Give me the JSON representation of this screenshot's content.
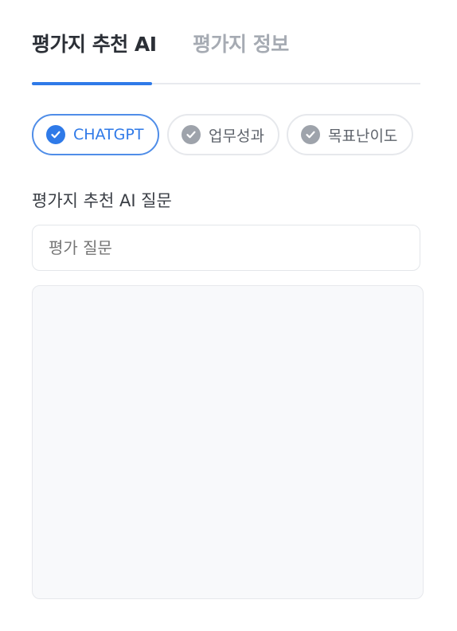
{
  "tabs": [
    {
      "label": "평가지 추천 AI",
      "active": true
    },
    {
      "label": "평가지 정보",
      "active": false
    }
  ],
  "chips": [
    {
      "label": "CHATGPT",
      "selected": true,
      "icon": "check-circle-icon"
    },
    {
      "label": "업무성과",
      "selected": false,
      "icon": "check-circle-icon"
    },
    {
      "label": "목표난이도",
      "selected": false,
      "icon": "check-circle-icon"
    }
  ],
  "form": {
    "label": "평가지 추천 AI 질문",
    "question_placeholder": "평가 질문",
    "question_value": "",
    "answer_value": ""
  },
  "colors": {
    "accent": "#2f7ae8",
    "chip_selected_border": "#4f8de8",
    "chip_unselected_check": "#9ea3ab",
    "answer_background": "#f8f9fb"
  }
}
